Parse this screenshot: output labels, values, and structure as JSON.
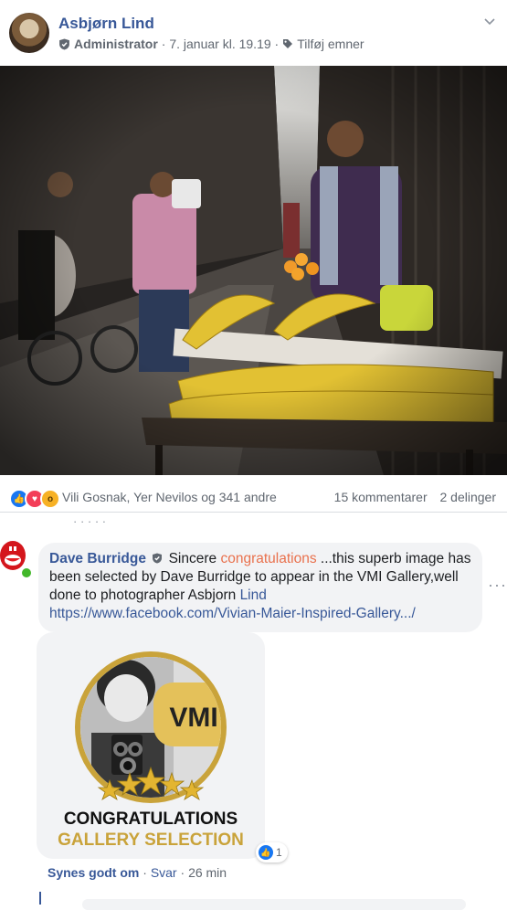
{
  "post": {
    "author": "Asbjørn Lind",
    "role": "Administrator",
    "date": "· 7. januar kl. 19.19 ·",
    "add_topic": "Tilføj emner"
  },
  "reactions": {
    "names": "Vili Gosnak, Yer Nevilos og 341 andre",
    "comments": "15 kommentarer",
    "shares": "2 delinger"
  },
  "comment": {
    "author": "Dave Burridge",
    "text_1": "Sincere",
    "highlight": "congratulations",
    "text_2": "...this superb image has been selected by Dave Burridge to appear in the VMI Gallery,well done to photographer Asbjorn",
    "mention": "Lind",
    "link": "https://www.facebook.com/Vivian-Maier-Inspired-Gallery.../",
    "badge": {
      "logo": "VMI",
      "line1": "CONGRATULATIONS",
      "line2": "GALLERY SELECTION"
    },
    "reaction_count": "1",
    "like_label": "Synes godt om",
    "reply_label": "Svar",
    "time": "26 min"
  },
  "colors": {
    "link_blue": "#385898",
    "highlight_orange": "#e9714d",
    "gold": "#c9a33a"
  }
}
